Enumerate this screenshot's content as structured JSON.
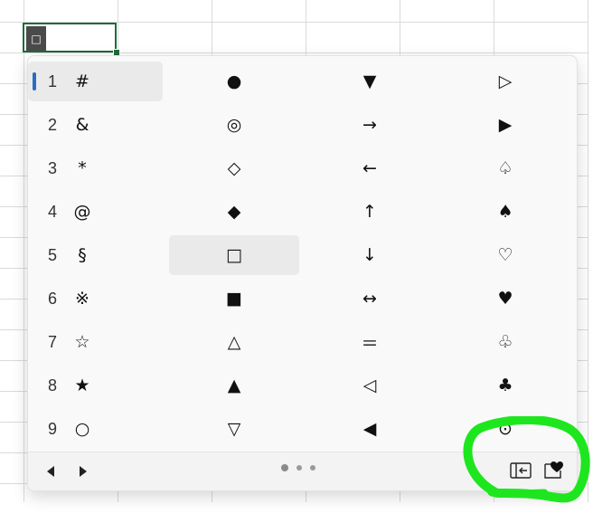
{
  "spreadsheet": {
    "active_cell_value": "□"
  },
  "symbol_picker": {
    "columns": [
      [
        {
          "num": "1",
          "sym": "#"
        },
        {
          "num": "2",
          "sym": "&"
        },
        {
          "num": "3",
          "sym": "*"
        },
        {
          "num": "4",
          "sym": "@"
        },
        {
          "num": "5",
          "sym": "§"
        },
        {
          "num": "6",
          "sym": "※"
        },
        {
          "num": "7",
          "sym": "☆"
        },
        {
          "num": "8",
          "sym": "★"
        },
        {
          "num": "9",
          "sym": "○"
        }
      ],
      [
        "●",
        "◎",
        "◇",
        "◆",
        "□",
        "■",
        "△",
        "▲",
        "▽"
      ],
      [
        "▼",
        "→",
        "←",
        "↑",
        "↓",
        "↔",
        "＝",
        "◁",
        "◀"
      ],
      [
        "▷",
        "▶",
        "♤",
        "♠",
        "♡",
        "♥",
        "♧",
        "♣",
        "⊙"
      ]
    ],
    "selected_item": "□",
    "footer": {
      "prev_icon": "previous-page-icon",
      "next_icon": "next-page-icon",
      "page_dots": 3,
      "active_page": 1,
      "sidebar_icon": "panel-back-icon",
      "favorite_icon": "heart-box-icon"
    }
  },
  "colors": {
    "focus_indicator": "#2a6cc4",
    "cell_border": "#1e6b3c",
    "annotation": "#1ee61e"
  }
}
